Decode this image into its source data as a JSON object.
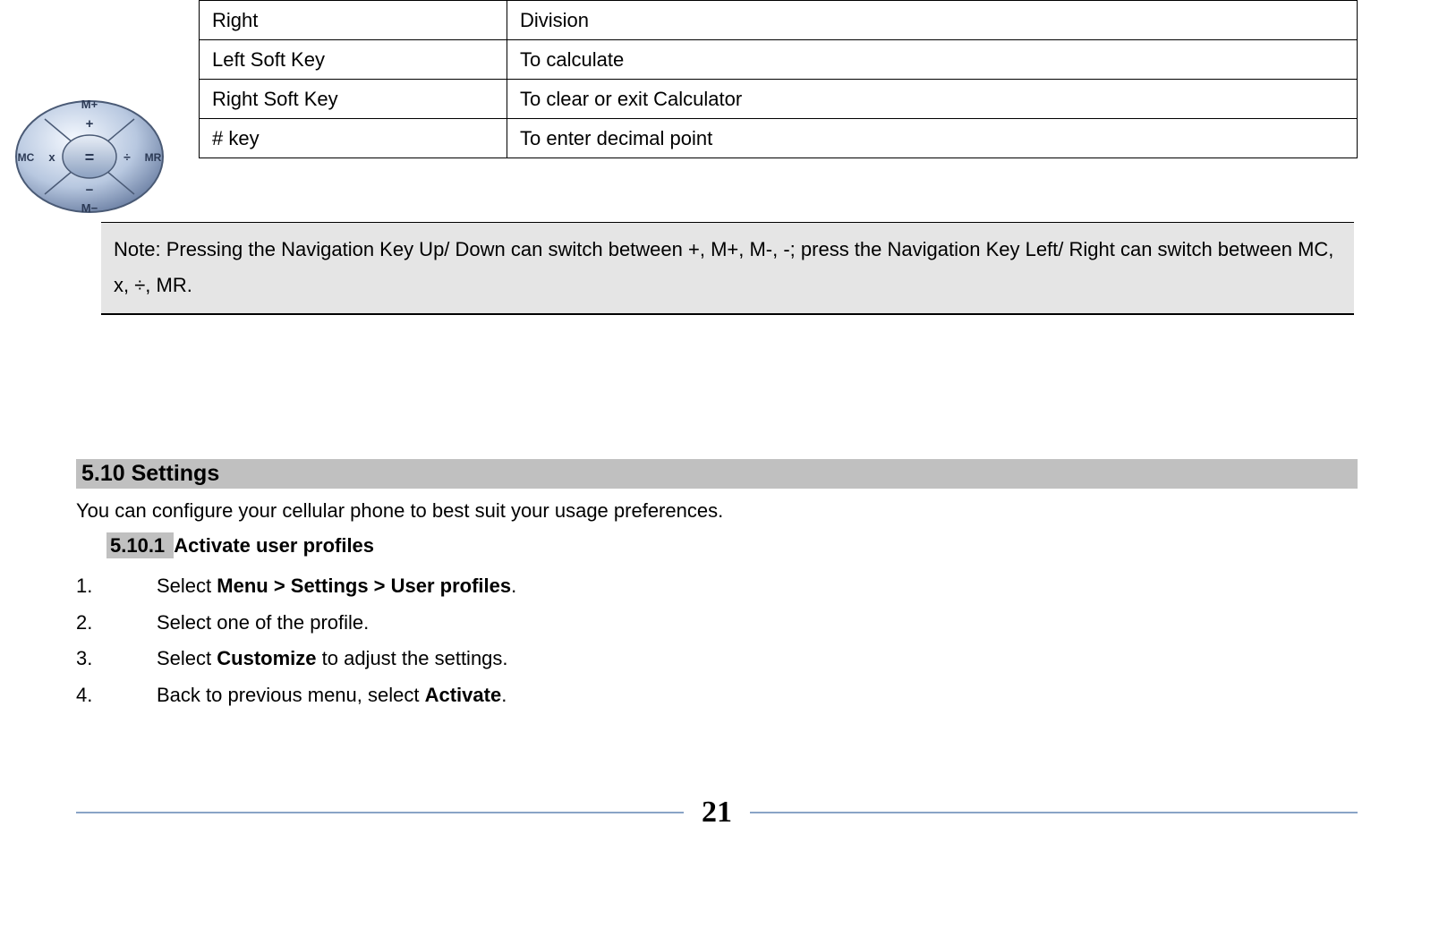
{
  "table": {
    "rows": [
      {
        "key": "Right",
        "action": "Division"
      },
      {
        "key": "Left Soft Key",
        "action": "To calculate"
      },
      {
        "key": "Right Soft Key",
        "action": "To clear or exit Calculator"
      },
      {
        "key": "# key",
        "action": "To enter decimal point"
      }
    ]
  },
  "note": "Note: Pressing the Navigation Key Up/ Down can switch between +, M+, M-, -; press the Navigation Key Left/ Right can switch between MC, x, ÷, MR.",
  "section510": {
    "heading": "5.10 Settings",
    "intro": "You can configure your cellular phone to best suit your usage preferences.",
    "sub": {
      "num": "5.10.1 ",
      "title": "Activate user profiles"
    },
    "steps": [
      {
        "n": "1.",
        "prefix": "Select ",
        "bold": "Menu > Settings > User profiles",
        "suffix": "."
      },
      {
        "n": "2.",
        "prefix": "Select one of the profile.",
        "bold": "",
        "suffix": ""
      },
      {
        "n": "3.",
        "prefix": "Select ",
        "bold": "Customize",
        "suffix": " to adjust the settings."
      },
      {
        "n": "4.",
        "prefix": "Back to previous menu, select ",
        "bold": "Activate",
        "suffix": "."
      }
    ]
  },
  "pageNumber": "21",
  "navpad": {
    "up": "M+",
    "upInner": "+",
    "down": "M−",
    "downInner": "−",
    "left": "MC",
    "leftInner": "x",
    "right": "MR",
    "rightInner": "÷",
    "center": "="
  }
}
